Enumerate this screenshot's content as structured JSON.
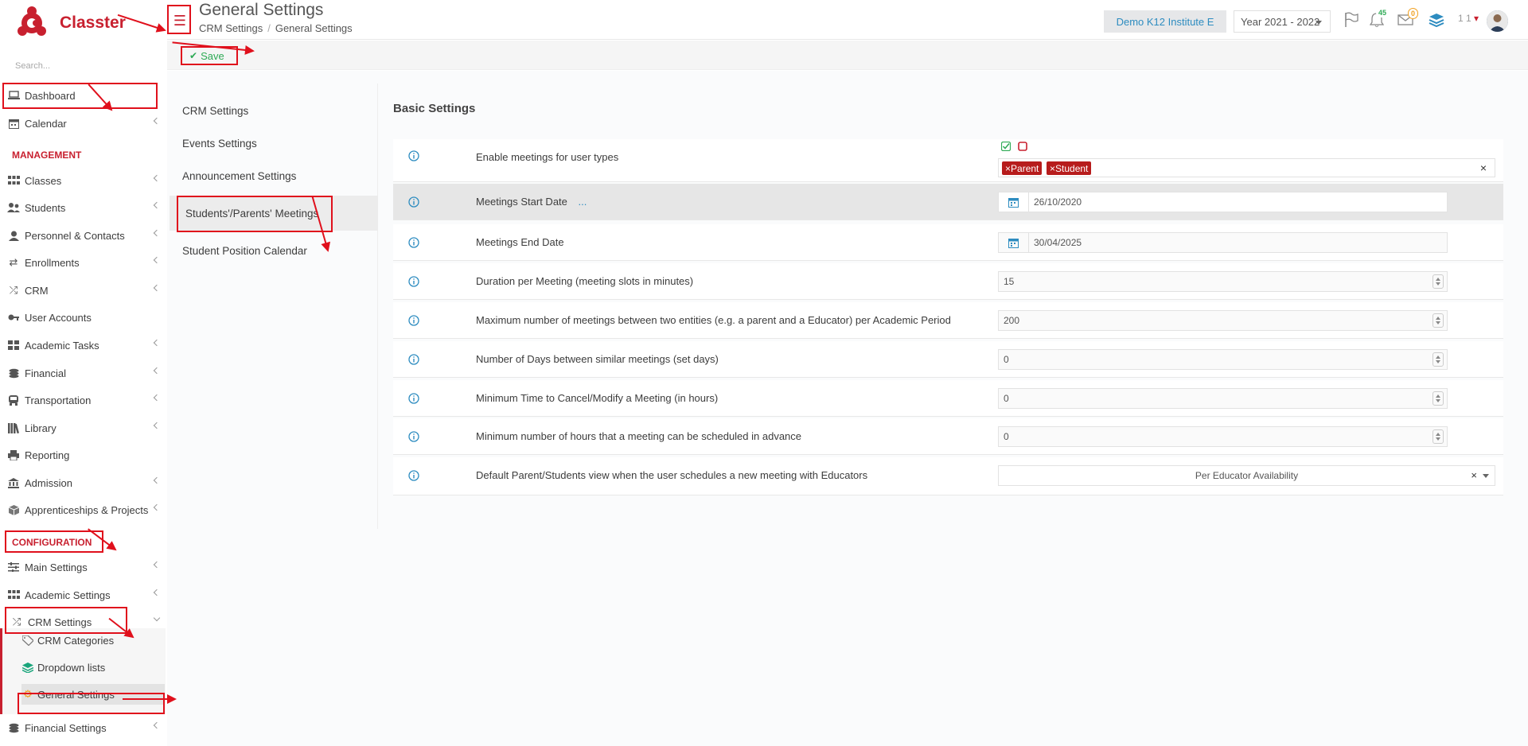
{
  "app": {
    "name": "Classter"
  },
  "search": {
    "placeholder": "Search..."
  },
  "sidebar": {
    "items": [
      {
        "label": "Dashboard"
      },
      {
        "label": "Calendar"
      },
      {
        "label": "Classes"
      },
      {
        "label": "Students"
      },
      {
        "label": "Personnel & Contacts"
      },
      {
        "label": "Enrollments"
      },
      {
        "label": "CRM"
      },
      {
        "label": "User Accounts"
      },
      {
        "label": "Academic Tasks"
      },
      {
        "label": "Financial"
      },
      {
        "label": "Transportation"
      },
      {
        "label": "Library"
      },
      {
        "label": "Reporting"
      },
      {
        "label": "Admission"
      },
      {
        "label": "Apprenticeships & Projects"
      },
      {
        "label": "Main Settings"
      },
      {
        "label": "Academic Settings"
      },
      {
        "label": "CRM Settings"
      },
      {
        "label": "Financial Settings"
      }
    ],
    "sections": {
      "management": "MANAGEMENT",
      "configuration": "CONFIGURATION"
    },
    "crm_sub": [
      {
        "label": "CRM Categories"
      },
      {
        "label": "Dropdown lists"
      },
      {
        "label": "General Settings"
      }
    ]
  },
  "header": {
    "title": "General Settings",
    "breadcrumb": [
      "CRM Settings",
      "General Settings"
    ],
    "institute": "Demo K12 Institute E",
    "year": "Year 2021 - 2022",
    "notifications": "45",
    "messages": "0",
    "user": "1 1"
  },
  "toolbar": {
    "save_label": "Save"
  },
  "settings_nav": [
    {
      "label": "CRM Settings"
    },
    {
      "label": "Events Settings"
    },
    {
      "label": "Announcement Settings"
    },
    {
      "label": "Students'/Parents' Meetings"
    },
    {
      "label": "Student Position Calendar"
    }
  ],
  "basic": {
    "title": "Basic Settings",
    "rows": [
      {
        "label": "Enable meetings for user types",
        "tags": [
          "Parent",
          "Student"
        ]
      },
      {
        "label": "Meetings Start Date",
        "extra": "...",
        "value": "26/10/2020"
      },
      {
        "label": "Meetings End Date",
        "value": "30/04/2025"
      },
      {
        "label": "Duration per Meeting (meeting slots in minutes)",
        "value": "15"
      },
      {
        "label": "Maximum number of meetings between two entities (e.g. a parent and a Educator) per Academic Period",
        "value": "200"
      },
      {
        "label": "Number of Days between similar meetings (set days)",
        "value": "0"
      },
      {
        "label": "Minimum Time to Cancel/Modify a Meeting (in hours)",
        "value": "0"
      },
      {
        "label": "Minimum number of hours that a meeting can be scheduled in advance",
        "value": "0"
      },
      {
        "label": "Default Parent/Students view when the user schedules a new meeting with Educators",
        "value": "Per Educator Availability"
      }
    ]
  },
  "colors": {
    "brand": "#c8202f",
    "accent": "#2d8cc0",
    "success": "#2eaa55",
    "annotation": "#e0101c"
  },
  "icons": [
    "menu-icon",
    "check-icon",
    "info-icon",
    "calendar-icon",
    "flag-icon",
    "bell-icon",
    "envelope-icon",
    "layers-icon",
    "tag-icon",
    "gear-icon"
  ]
}
